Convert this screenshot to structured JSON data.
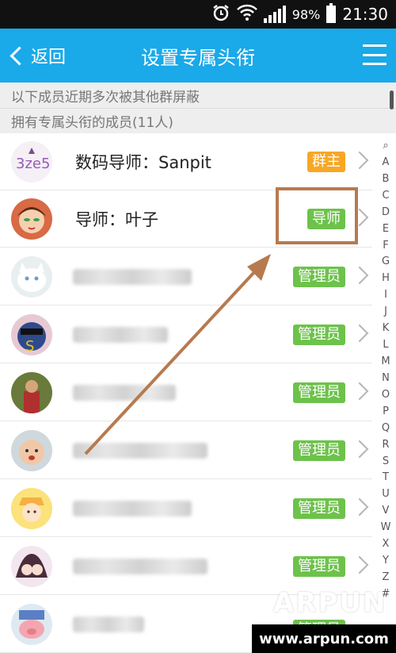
{
  "status_bar": {
    "battery": "98%",
    "battery_level": 0.98,
    "time": "21:30"
  },
  "header": {
    "back_label": "返回",
    "title": "设置专属头衔"
  },
  "sections": {
    "blocked_notice": "以下成员近期多次被其他群屏蔽",
    "members_header": "拥有专属头衔的成员(11人)"
  },
  "members": [
    {
      "name": "数码导师：Sanpit",
      "badge": "群主",
      "badge_color": "#f7a725"
    },
    {
      "name": "导师：叶子",
      "badge": "导师",
      "badge_color": "#6dc24b"
    },
    {
      "name": "",
      "badge": "管理员",
      "badge_color": "#6dc24b"
    },
    {
      "name": "",
      "badge": "管理员",
      "badge_color": "#6dc24b"
    },
    {
      "name": "",
      "badge": "管理员",
      "badge_color": "#6dc24b"
    },
    {
      "name": "",
      "badge": "管理员",
      "badge_color": "#6dc24b"
    },
    {
      "name": "",
      "badge": "管理员",
      "badge_color": "#6dc24b"
    },
    {
      "name": "",
      "badge": "管理员",
      "badge_color": "#6dc24b"
    },
    {
      "name": "",
      "badge": "管理员",
      "badge_color": "#6dc24b"
    }
  ],
  "index_letters": [
    "Q",
    "A",
    "B",
    "C",
    "D",
    "E",
    "F",
    "G",
    "H",
    "I",
    "J",
    "K",
    "L",
    "M",
    "N",
    "O",
    "P",
    "Q",
    "R",
    "S",
    "T",
    "U",
    "V",
    "W",
    "X",
    "Y",
    "Z",
    "#"
  ],
  "watermark": {
    "logo": "ARPUN",
    "url": "www.arpun.com"
  },
  "colors": {
    "header_bg": "#1aa9e9",
    "annotation": "#b77a4f"
  }
}
